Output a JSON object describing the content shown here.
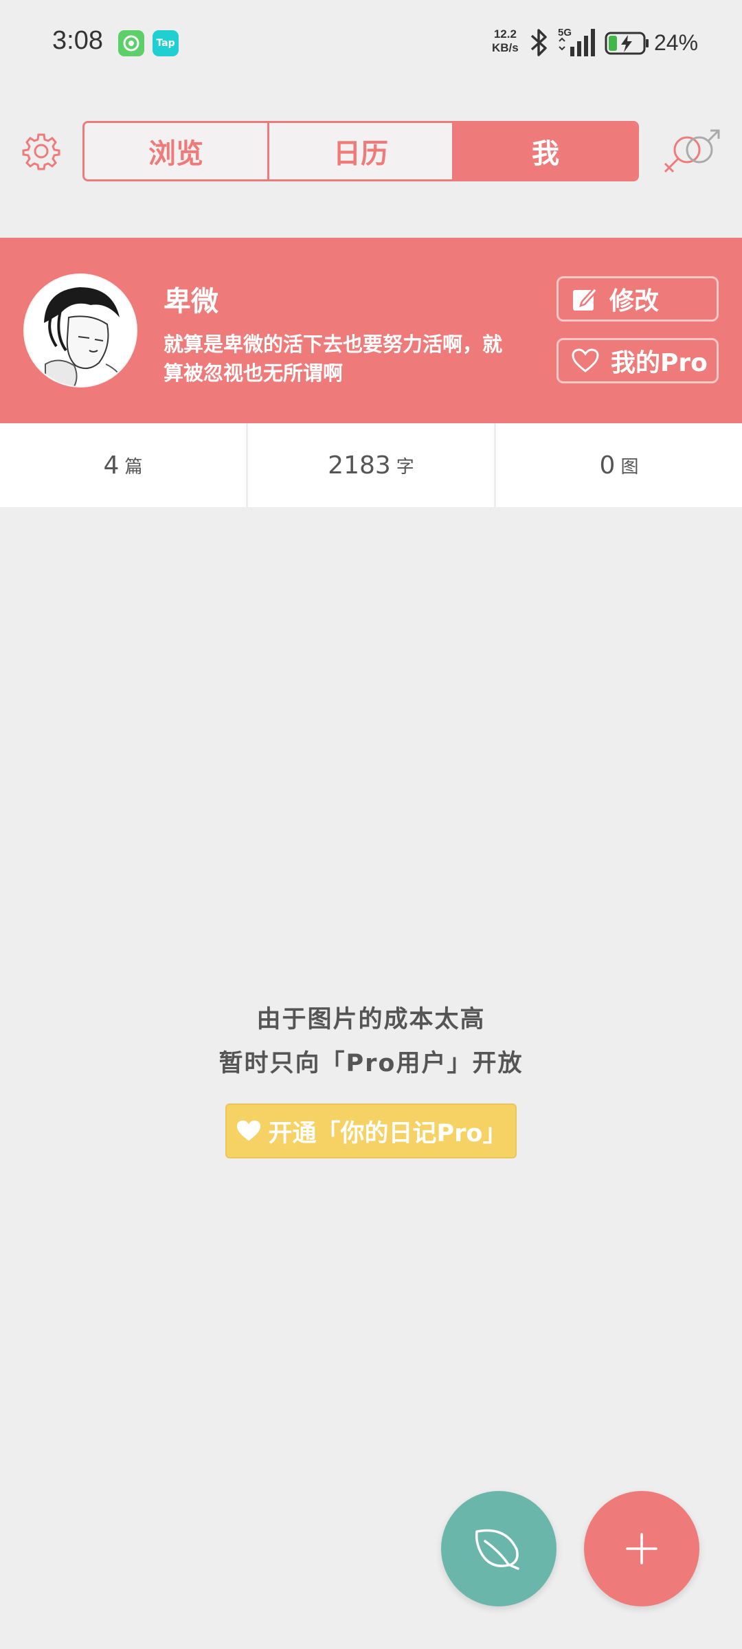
{
  "status_bar": {
    "time": "3:08",
    "app_icon_tap": "Tap",
    "net_speed_value": "12.2",
    "net_speed_unit": "KB/s",
    "network_type": "5G",
    "battery": "24%"
  },
  "nav": {
    "tabs": [
      {
        "label": "浏览",
        "active": false
      },
      {
        "label": "日历",
        "active": false
      },
      {
        "label": "我",
        "active": true
      }
    ]
  },
  "profile": {
    "username": "卑微",
    "bio": "就算是卑微的活下去也要努力活啊，就算被忽视也无所谓啊",
    "edit_label": "修改",
    "pro_label": "我的Pro"
  },
  "stats": [
    {
      "value": "4",
      "unit": "篇"
    },
    {
      "value": "2183",
      "unit": "字"
    },
    {
      "value": "0",
      "unit": "图"
    }
  ],
  "message": {
    "line1": "由于图片的成本太高",
    "line2": "暂时只向「Pro用户」开放",
    "cta": "开通「你的日记Pro」"
  },
  "colors": {
    "accent": "#ee7b79",
    "cta": "#f6d265",
    "fab_leaf": "#6bb6ab",
    "background": "#eeeeee"
  },
  "icons": [
    "gear-icon",
    "gender-icon",
    "edit-icon",
    "heart-icon",
    "leaf-icon",
    "plus-icon"
  ]
}
